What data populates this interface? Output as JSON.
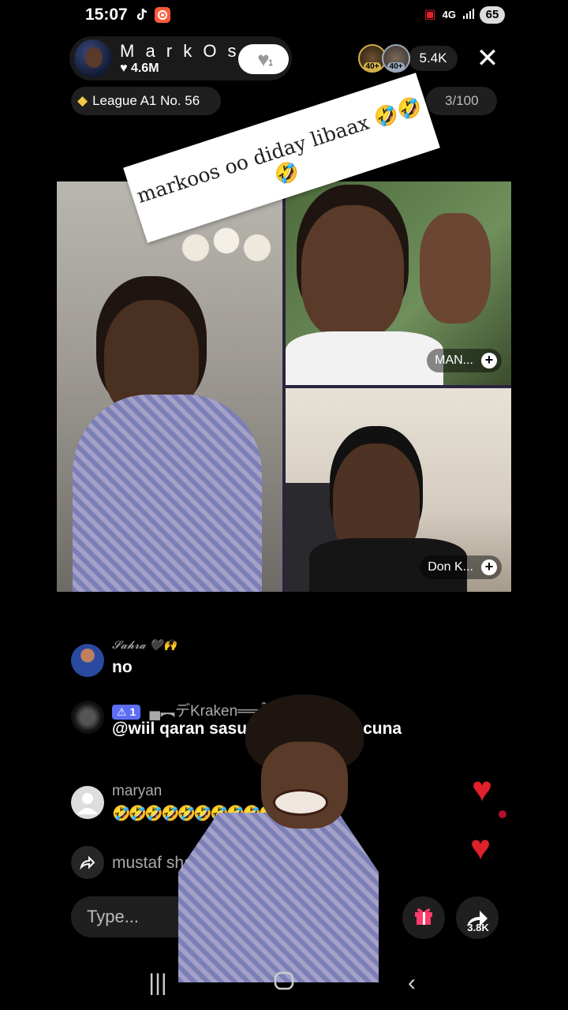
{
  "status_bar": {
    "time": "15:07",
    "network": "4G",
    "battery": "65"
  },
  "host": {
    "name": "M a r k O s :(",
    "likes": "♥ 4.6M",
    "follow_count": "1",
    "viewer_badges": [
      "40+",
      "40+"
    ],
    "viewer_count": "5.4K",
    "league": "League A1 No. 56",
    "progress": "3/100"
  },
  "sticker": {
    "text": "markoos oo diday libaax 🤣🤣🤣"
  },
  "guests": [
    {
      "label": "MAN..."
    },
    {
      "label": "Don K..."
    }
  ],
  "comments": [
    {
      "user": "𝓢𝓪𝓱𝓻𝓪 🖤🙌",
      "text": "no"
    },
    {
      "level": "⚠ 1",
      "user": "▄︻デKraken══ÂmZe✰",
      "text": "@wiil qaran sasu... somali wa lacuna"
    },
    {
      "user": "maryan",
      "text": "🤣🤣🤣🤣🤣🤣🤣🤣🤣🤣🤣🤣🤣"
    },
    {
      "user": "mustaf sha..."
    }
  ],
  "input": {
    "placeholder": "Type..."
  },
  "share": {
    "count": "3.8K"
  },
  "colors": {
    "heart": "#e0202a",
    "badge": "#5b6ef5"
  }
}
